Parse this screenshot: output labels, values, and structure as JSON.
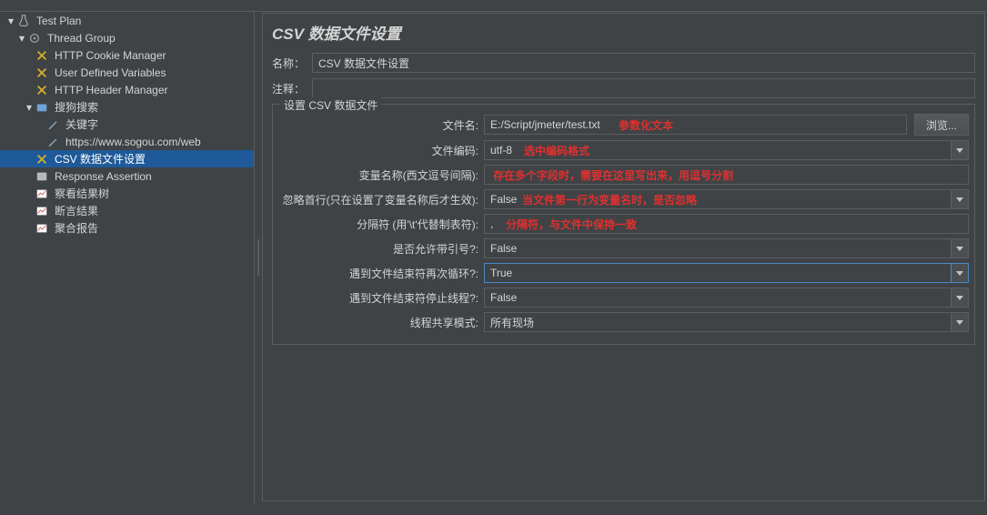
{
  "tree": {
    "root": "Test Plan",
    "thread_group": "Thread Group",
    "cookie_mgr": "HTTP Cookie Manager",
    "user_vars": "User Defined Variables",
    "header_mgr": "HTTP Header Manager",
    "sogou": "搜狗搜索",
    "keyword": "关键字",
    "sogou_url": "https://www.sogou.com/web",
    "csv_config": "CSV 数据文件设置",
    "resp_assert": "Response Assertion",
    "view_tree": "察看结果树",
    "assert_result": "断言结果",
    "agg_report": "聚合报告"
  },
  "panel": {
    "title": "CSV 数据文件设置",
    "name_label": "名称：",
    "name_value": "CSV 数据文件设置",
    "comment_label": "注释：",
    "comment_value": "",
    "group_legend": "设置 CSV 数据文件"
  },
  "fields": {
    "filename_label": "文件名:",
    "filename_value": "E:/Script/jmeter/test.txt",
    "browse_label": "浏览...",
    "encoding_label": "文件编码:",
    "encoding_value": "utf-8",
    "varnames_label": "变量名称(西文逗号间隔):",
    "varnames_value": "",
    "ignore_first_label": "忽略首行(只在设置了变量名称后才生效):",
    "ignore_first_value": "False",
    "delimiter_label": "分隔符 (用'\\t'代替制表符):",
    "delimiter_value": ",",
    "allow_quoted_label": "是否允许带引号?:",
    "allow_quoted_value": "False",
    "recycle_label": "遇到文件结束符再次循环?:",
    "recycle_value": "True",
    "stop_eof_label": "遇到文件结束符停止线程?:",
    "stop_eof_value": "False",
    "share_mode_label": "线程共享模式:",
    "share_mode_value": "所有现场"
  },
  "annotations": {
    "a1": "参数化文本",
    "a2": "选中编码格式",
    "a3": "存在多个字段时，需要在这里写出来，用逗号分割",
    "a4": "当文件第一行为变量名时，是否忽略",
    "a5": "分隔符，与文件中保持一致"
  }
}
